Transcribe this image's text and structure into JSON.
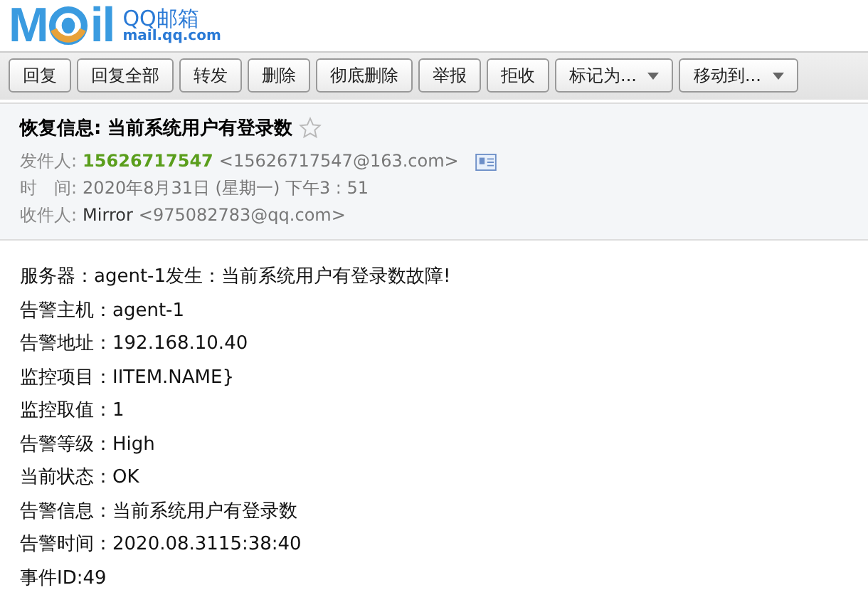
{
  "logo": {
    "left": "M",
    "right": "il",
    "product": "QQ邮箱",
    "domain": "mail.qq.com"
  },
  "toolbar": [
    {
      "label": "回复",
      "kind": "plain"
    },
    {
      "label": "回复全部",
      "kind": "plain"
    },
    {
      "label": "转发",
      "kind": "plain"
    },
    {
      "label": "删除",
      "kind": "plain"
    },
    {
      "label": "彻底删除",
      "kind": "plain"
    },
    {
      "label": "举报",
      "kind": "plain"
    },
    {
      "label": "拒收",
      "kind": "plain"
    },
    {
      "label": "标记为...",
      "kind": "dropdown"
    },
    {
      "label": "移动到...",
      "kind": "dropdown"
    }
  ],
  "header": {
    "subject": "恢复信息: 当前系统用户有登录数",
    "starred": false,
    "fields": [
      {
        "label": "发件人:",
        "name": "15626717547",
        "address": "<15626717547@163.com>",
        "kind": "sender"
      },
      {
        "label": "时　间:",
        "address": "2020年8月31日 (星期一) 下午3 : 51",
        "kind": "plain"
      },
      {
        "label": "收件人:",
        "name": "Mirror",
        "address": "<975082783@qq.com>",
        "kind": "recipient"
      }
    ]
  },
  "body": [
    "服务器：agent-1发生：当前系统用户有登录数故障!",
    "告警主机：agent-1",
    "告警地址：192.168.10.40",
    "监控项目：IITEM.NAME}",
    "监控取值：1",
    "告警等级：High",
    "当前状态：OK",
    "告警信息：当前系统用户有登录数",
    "告警时间：2020.08.3115:38:40",
    "事件ID:49"
  ]
}
